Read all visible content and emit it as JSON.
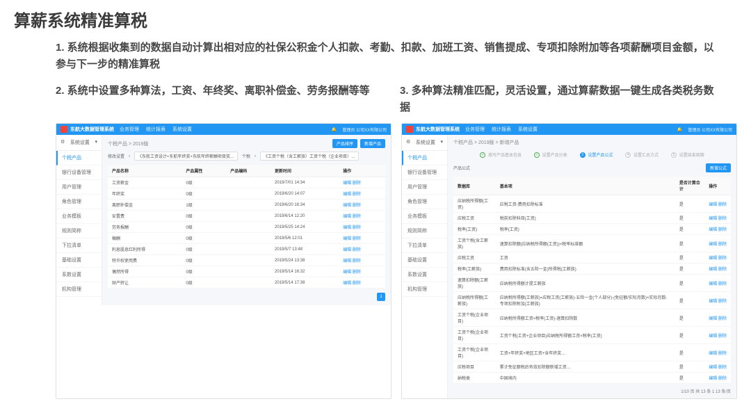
{
  "slide": {
    "title": "算薪系统精准算税",
    "desc1": "1. 系统根据收集到的数据自动计算出相对应的社保公积金个人扣款、考勤、扣款、加班工资、销售提成、专项扣除附加等各项薪酬项目金额，以参与下一步的精准算税",
    "desc2": "2. 系统中设置多种算法，工资、年终奖、离职补偿金、劳务报酬等等",
    "desc3": "3. 多种算法精准匹配，灵活设置，通过算薪数据一键生成各类税务数据"
  },
  "app": {
    "brand": "东航大数据管理系统",
    "nav": [
      "业务管理",
      "统计报表",
      "系统设置"
    ],
    "rightText": "管理员 公司XX有限公司"
  },
  "sidebar": {
    "header": "系统设置",
    "items": [
      "个税产品",
      "银行设备管理",
      "用户管理",
      "角色管理",
      "业务模板",
      "规则简称",
      "下拉清单",
      "基础设置",
      "系数设置",
      "机构管理"
    ],
    "activeIndex": 0
  },
  "screen1": {
    "breadcrumb": "个税产品 > 2019版",
    "btn1": "产品排序",
    "btn2": "新增产品",
    "filter": {
      "label1": "修改设置",
      "val1": "《东航工资设计+东航年终奖+东航年终薪酬项目奖…",
      "label2": "个税",
      "val2": "《工资个税（含工薪族）工资个税（企业项目）…"
    },
    "columns": [
      "产品名称",
      "产品属性",
      "产品编码",
      "更新时间",
      "操作"
    ],
    "rows": [
      {
        "c1": "工资薪金",
        "c2": "0级",
        "c3": "",
        "c4": "2019/7/01 14:34",
        "c5": "编辑  删除"
      },
      {
        "c1": "年终奖",
        "c2": "0级",
        "c3": "",
        "c4": "2019/6/20 14:07",
        "c5": "编辑  删除"
      },
      {
        "c1": "离职补偿金",
        "c2": "1级",
        "c3": "",
        "c4": "2019/6/20 16:34",
        "c5": "编辑  删除"
      },
      {
        "c1": "安置费",
        "c2": "0级",
        "c3": "",
        "c4": "2019/6/14 12:20",
        "c5": "编辑  删除"
      },
      {
        "c1": "劳务报酬",
        "c2": "0级",
        "c3": "",
        "c4": "2019/5/25 14:24",
        "c5": "编辑  删除"
      },
      {
        "c1": "稿酬",
        "c2": "0级",
        "c3": "",
        "c4": "2019/5/6 12:01",
        "c5": "编辑  删除"
      },
      {
        "c1": "利息股息红利所得",
        "c2": "0级",
        "c3": "",
        "c4": "2019/5/7 13:48",
        "c5": "编辑  删除"
      },
      {
        "c1": "特许权使用费",
        "c2": "0级",
        "c3": "",
        "c4": "2019/5/24 13:38",
        "c5": "编辑  删除"
      },
      {
        "c1": "偶然所得",
        "c2": "0级",
        "c3": "",
        "c4": "2019/5/14 16:32",
        "c5": "编辑  删除"
      },
      {
        "c1": "财产转让",
        "c2": "0级",
        "c3": "",
        "c4": "2019/5/14 17:38",
        "c5": "编辑  删除"
      }
    ],
    "page": "1"
  },
  "screen2": {
    "breadcrumb": "个税产品 > 2019版 > 新增产品",
    "steps": [
      "填写产品基本信息",
      "设置产品分类",
      "设置产品公式",
      "设置汇总方式",
      "设置结束周期"
    ],
    "activeStep": 2,
    "secTitle": "产品公式",
    "btn": "新增公式",
    "columns": [
      "数据库",
      "基本项",
      "是否计算合计",
      "操作"
    ],
    "rows": [
      {
        "c1": "应纳税所得额(工资)",
        "c2": "应税工资-费用扣除标准",
        "c3": "是",
        "c4": "编辑  删除"
      },
      {
        "c1": "应税工资",
        "c2": "税前扣除科目(工资)",
        "c3": "是",
        "c4": "编辑  删除"
      },
      {
        "c1": "税率(工资)",
        "c2": "税率(工资)",
        "c3": "是",
        "c4": "编辑  删除"
      },
      {
        "c1": "工资个税(含工薪族)",
        "c2": "速算扣除额(应纳税所得额(工资))×税率标准额",
        "c3": "是",
        "c4": "编辑  删除"
      },
      {
        "c1": "应税工资",
        "c2": "工资",
        "c3": "是",
        "c4": "编辑  删除"
      },
      {
        "c1": "税率(工薪族)",
        "c2": "费用扣除标准(含五险一金)所得税(工薪族)",
        "c3": "是",
        "c4": "编辑  删除"
      },
      {
        "c1": "速算扣除额(工薪族)",
        "c2": "应纳税所得额计提工薪族",
        "c3": "是",
        "c4": "编辑  删除"
      },
      {
        "c1": "应纳税所得额(工薪族)",
        "c2": "应纳税所得额(工薪族)=应税工资(工薪族)-五险一金(个人部分)-(免征额/实际月数)×实际月数-专项扣除附加(工薪族)",
        "c3": "是",
        "c4": "编辑  删除"
      },
      {
        "c1": "工资个税(企业项目)",
        "c2": "应纳税所得额工资×税率(工资)-速算扣除数",
        "c3": "是",
        "c4": "编辑  删除"
      },
      {
        "c1": "工资个税(企业项目)",
        "c2": "工资个税(工资+企业项目)应纳税所得额工资×税率(工资)",
        "c3": "是",
        "c4": "编辑  删除"
      },
      {
        "c1": "工资个税(企业项目)",
        "c2": "工资+年终奖+地区工资+含年终奖…",
        "c3": "是",
        "c4": "编辑  删除"
      },
      {
        "c1": "应税项目",
        "c2": "累计免征额税后有效扣除额新增工资…",
        "c3": "是",
        "c4": "编辑  删除"
      },
      {
        "c1": "纳税类",
        "c2": "中国境内",
        "c3": "是",
        "c4": "编辑  删除"
      }
    ],
    "pager": "1/10 页 共 13 条  1  13 条/页"
  }
}
